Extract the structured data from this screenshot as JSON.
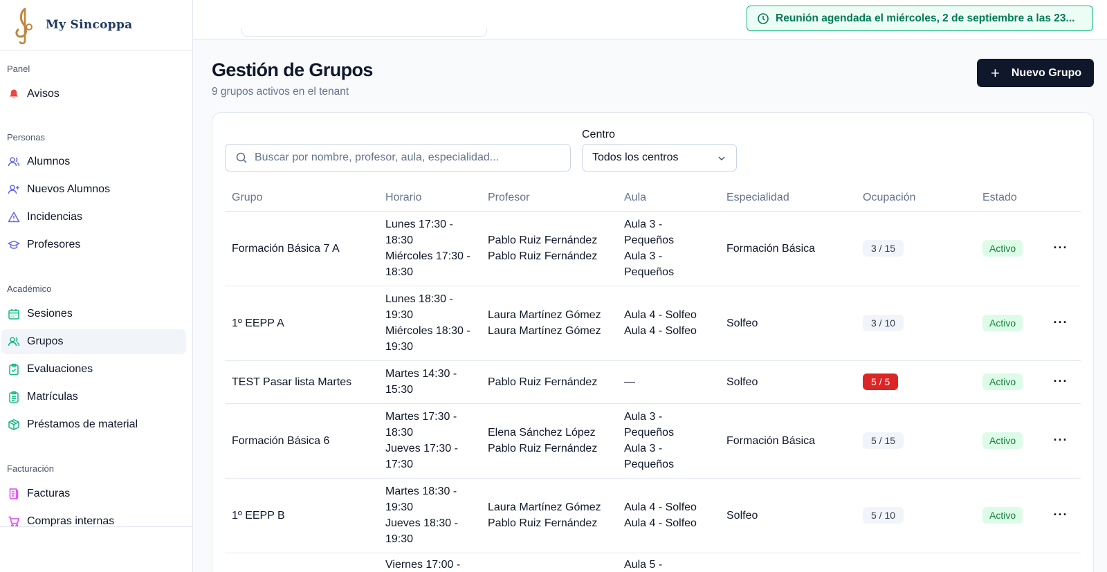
{
  "brand": {
    "name": "My Sincoppa"
  },
  "sidebar": {
    "sections": [
      {
        "title": "Panel",
        "items": [
          {
            "label": "Avisos",
            "icon": "bell-icon"
          }
        ]
      },
      {
        "title": "Personas",
        "items": [
          {
            "label": "Alumnos",
            "icon": "users-icon"
          },
          {
            "label": "Nuevos Alumnos",
            "icon": "user-plus-icon"
          },
          {
            "label": "Incidencias",
            "icon": "alert-triangle-icon"
          },
          {
            "label": "Profesores",
            "icon": "graduation-cap-icon"
          }
        ]
      },
      {
        "title": "Académico",
        "items": [
          {
            "label": "Sesiones",
            "icon": "calendar-icon"
          },
          {
            "label": "Grupos",
            "icon": "users-group-icon",
            "active": true
          },
          {
            "label": "Evaluaciones",
            "icon": "clipboard-check-icon"
          },
          {
            "label": "Matrículas",
            "icon": "clipboard-list-icon"
          },
          {
            "label": "Préstamos de material",
            "icon": "package-icon"
          }
        ]
      },
      {
        "title": "Facturación",
        "items": [
          {
            "label": "Facturas",
            "icon": "receipt-icon"
          },
          {
            "label": "Compras internas",
            "icon": "shopping-cart-icon"
          }
        ]
      }
    ]
  },
  "toast": {
    "text": "Reunión agendada el miércoles, 2 de septiembre a las 23...",
    "icon": "clock-icon"
  },
  "page": {
    "title": "Gestión de Grupos",
    "subtitle": "9 grupos activos en el tenant",
    "new_button": "Nuevo Grupo"
  },
  "filters": {
    "search_placeholder": "Buscar por nombre, profesor, aula, especialidad...",
    "centro_label": "Centro",
    "centro_value": "Todos los centros"
  },
  "table": {
    "columns": [
      "Grupo",
      "Horario",
      "Profesor",
      "Aula",
      "Especialidad",
      "Ocupación",
      "Estado"
    ],
    "rows": [
      {
        "grupo": "Formación Básica 7 A",
        "horario": [
          "Lunes 17:30 -",
          "18:30",
          "Miércoles 17:30 -",
          "18:30"
        ],
        "profesor": [
          "Pablo Ruiz Fernández",
          "Pablo Ruiz Fernández"
        ],
        "aula": [
          "Aula 3 -",
          "Pequeños",
          "Aula 3 -",
          "Pequeños"
        ],
        "especialidad": "Formación Básica",
        "ocupacion": "3 / 15",
        "full": false,
        "estado": "Activo"
      },
      {
        "grupo": "1º EEPP A",
        "horario": [
          "Lunes 18:30 -",
          "19:30",
          "Miércoles 18:30 -",
          "19:30"
        ],
        "profesor": [
          "Laura Martínez Gómez",
          "Laura Martínez Gómez"
        ],
        "aula": [
          "Aula 4 - Solfeo",
          "Aula 4 - Solfeo"
        ],
        "especialidad": "Solfeo",
        "ocupacion": "3 / 10",
        "full": false,
        "estado": "Activo"
      },
      {
        "grupo": "TEST Pasar lista Martes",
        "horario": [
          "Martes 14:30 -",
          "15:30"
        ],
        "profesor": [
          "Pablo Ruiz Fernández"
        ],
        "aula": [
          "—"
        ],
        "especialidad": "Solfeo",
        "ocupacion": "5 / 5",
        "full": true,
        "estado": "Activo"
      },
      {
        "grupo": "Formación Básica 6",
        "horario": [
          "Martes 17:30 -",
          "18:30",
          "Jueves 17:30 -",
          "17:30"
        ],
        "profesor": [
          "Elena Sánchez López",
          "Pablo Ruiz Fernández"
        ],
        "aula": [
          "Aula 3 -",
          "Pequeños",
          "Aula 3 -",
          "Pequeños"
        ],
        "especialidad": "Formación Básica",
        "ocupacion": "5 / 15",
        "full": false,
        "estado": "Activo"
      },
      {
        "grupo": "1º EEPP B",
        "horario": [
          "Martes 18:30 -",
          "19:30",
          "Jueves 18:30 -",
          "19:30"
        ],
        "profesor": [
          "Laura Martínez Gómez",
          "Pablo Ruiz Fernández"
        ],
        "aula": [
          "Aula 4 - Solfeo",
          "Aula 4 - Solfeo"
        ],
        "especialidad": "Solfeo",
        "ocupacion": "5 / 10",
        "full": false,
        "estado": "Activo"
      },
      {
        "grupo": "",
        "horario": [
          "Viernes 17:00 -"
        ],
        "profesor": [],
        "aula": [
          "Aula 5 -"
        ],
        "especialidad": "",
        "ocupacion": "",
        "full": false,
        "estado": ""
      }
    ]
  },
  "colors": {
    "accent": "#0f172a",
    "success": "#10b981",
    "danger": "#dc2626",
    "brand": "#1e3a5f"
  }
}
